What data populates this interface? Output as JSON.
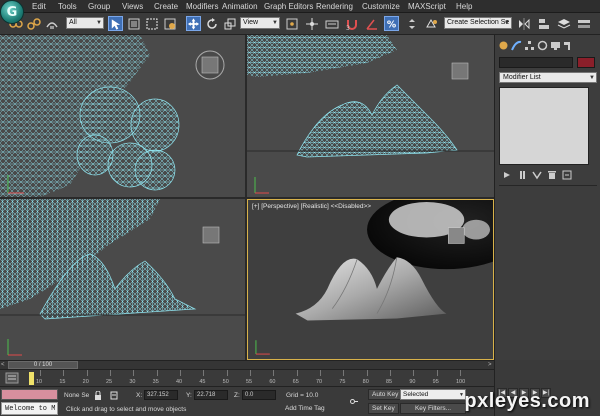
{
  "menu": {
    "items": [
      "Edit",
      "Tools",
      "Group",
      "Views",
      "Create",
      "Modifiers",
      "Animation",
      "Graph Editors",
      "Rendering",
      "Customize",
      "MAXScript",
      "Help"
    ]
  },
  "toolbar": {
    "selection_filter": "All",
    "reference_coord": "View",
    "named_selection_placeholder": "Create Selection Se"
  },
  "viewports": {
    "perspective_label": "[+] [Perspective] [Realistic]  <<Disabled>>"
  },
  "command_panel": {
    "modifier_list": "Modifier List"
  },
  "time_slider": {
    "frame_display": "0 / 100",
    "prev_arrow": "<",
    "next_arrow": ">"
  },
  "track_bar": {
    "ticks": [
      "10",
      "15",
      "20",
      "25",
      "30",
      "35",
      "40",
      "45",
      "50",
      "55",
      "60",
      "65",
      "70",
      "75",
      "80",
      "85",
      "90",
      "95",
      "100"
    ]
  },
  "status": {
    "selection": "None Se",
    "x_label": "X:",
    "x_value": "327.152",
    "y_label": "Y:",
    "y_value": "22.718",
    "z_label": "Z:",
    "z_value": "0.0",
    "grid": "Grid = 10.0",
    "prompt": "Click and drag to select and move objects",
    "add_time_tag": "Add Time Tag",
    "auto_key": "Auto Key",
    "set_key": "Set Key",
    "key_mode": "Selected",
    "key_filters": "Key Filters...",
    "maxscript_listener": "Welcome to M"
  },
  "watermark": "pxleyes.com",
  "colors": {
    "wireframe": "#8fe3ee",
    "active_viewport_border": "#d8b24a",
    "object_color": "#8b1f2a",
    "app_logo": "#1e7f77"
  }
}
